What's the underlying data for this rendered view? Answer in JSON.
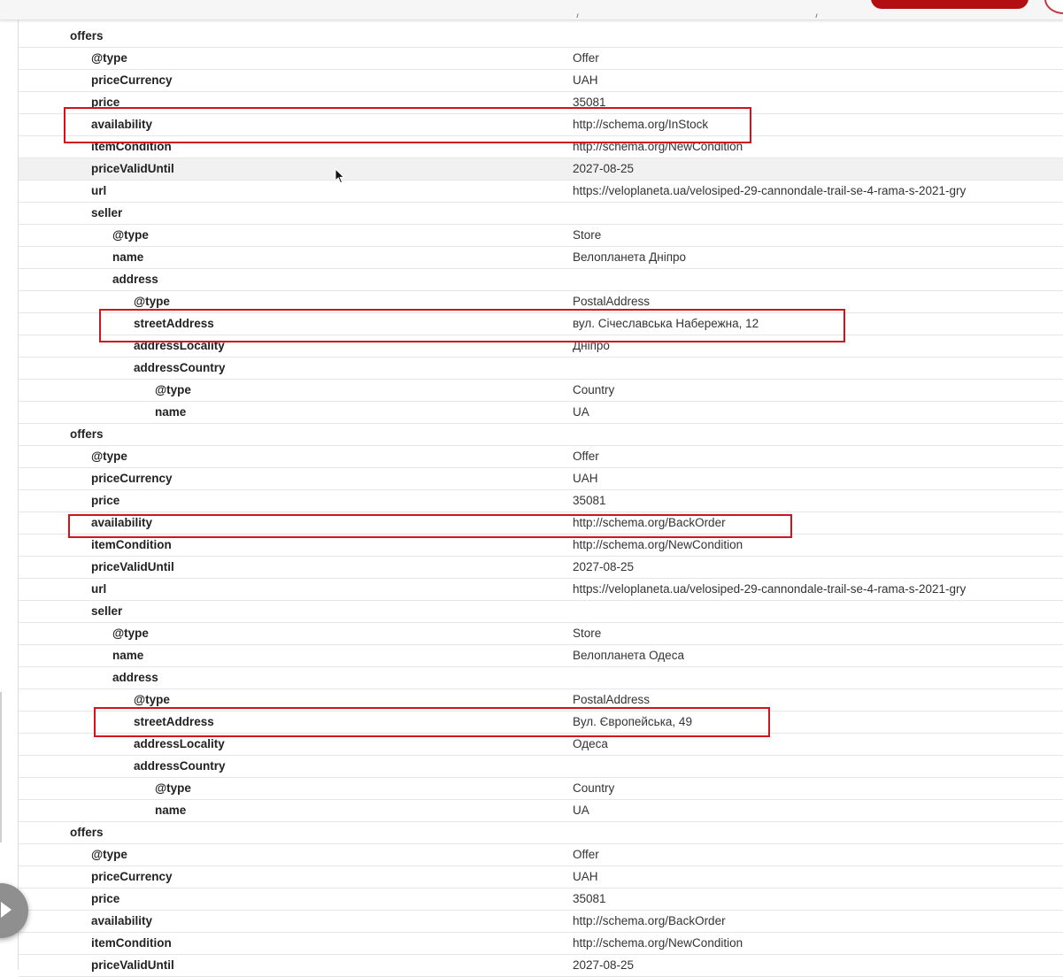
{
  "header": {
    "cut_text_left": "/",
    "cut_text_right": "/"
  },
  "rows": [
    {
      "key": "offers",
      "value": "",
      "indent": 0
    },
    {
      "key": "@type",
      "value": "Offer",
      "indent": 1
    },
    {
      "key": "priceCurrency",
      "value": "UAH",
      "indent": 1
    },
    {
      "key": "price",
      "value": "35081",
      "indent": 1
    },
    {
      "key": "availability",
      "value": "http://schema.org/InStock",
      "indent": 1
    },
    {
      "key": "itemCondition",
      "value": "http://schema.org/NewCondition",
      "indent": 1
    },
    {
      "key": "priceValidUntil",
      "value": "2027-08-25",
      "indent": 1,
      "hover": true
    },
    {
      "key": "url",
      "value": "https://veloplaneta.ua/velosiped-29-cannondale-trail-se-4-rama-s-2021-gry",
      "indent": 1
    },
    {
      "key": "seller",
      "value": "",
      "indent": 1
    },
    {
      "key": "@type",
      "value": "Store",
      "indent": 2
    },
    {
      "key": "name",
      "value": "Велопланета Дніпро",
      "indent": 2
    },
    {
      "key": "address",
      "value": "",
      "indent": 2
    },
    {
      "key": "@type",
      "value": "PostalAddress",
      "indent": 3
    },
    {
      "key": "streetAddress",
      "value": "вул. Січеславська Набережна, 12",
      "indent": 3
    },
    {
      "key": "addressLocality",
      "value": "Дніпро",
      "indent": 3
    },
    {
      "key": "addressCountry",
      "value": "",
      "indent": 3
    },
    {
      "key": "@type",
      "value": "Country",
      "indent": 4
    },
    {
      "key": "name",
      "value": "UA",
      "indent": 4
    },
    {
      "key": "offers",
      "value": "",
      "indent": 0
    },
    {
      "key": "@type",
      "value": "Offer",
      "indent": 1
    },
    {
      "key": "priceCurrency",
      "value": "UAH",
      "indent": 1
    },
    {
      "key": "price",
      "value": "35081",
      "indent": 1
    },
    {
      "key": "availability",
      "value": "http://schema.org/BackOrder",
      "indent": 1
    },
    {
      "key": "itemCondition",
      "value": "http://schema.org/NewCondition",
      "indent": 1
    },
    {
      "key": "priceValidUntil",
      "value": "2027-08-25",
      "indent": 1
    },
    {
      "key": "url",
      "value": "https://veloplaneta.ua/velosiped-29-cannondale-trail-se-4-rama-s-2021-gry",
      "indent": 1
    },
    {
      "key": "seller",
      "value": "",
      "indent": 1
    },
    {
      "key": "@type",
      "value": "Store",
      "indent": 2
    },
    {
      "key": "name",
      "value": "Велопланета Одеса",
      "indent": 2
    },
    {
      "key": "address",
      "value": "",
      "indent": 2
    },
    {
      "key": "@type",
      "value": "PostalAddress",
      "indent": 3
    },
    {
      "key": "streetAddress",
      "value": "Вул. Європейська, 49",
      "indent": 3
    },
    {
      "key": "addressLocality",
      "value": "Одеса",
      "indent": 3
    },
    {
      "key": "addressCountry",
      "value": "",
      "indent": 3
    },
    {
      "key": "@type",
      "value": "Country",
      "indent": 4
    },
    {
      "key": "name",
      "value": "UA",
      "indent": 4
    },
    {
      "key": "offers",
      "value": "",
      "indent": 0
    },
    {
      "key": "@type",
      "value": "Offer",
      "indent": 1
    },
    {
      "key": "priceCurrency",
      "value": "UAH",
      "indent": 1
    },
    {
      "key": "price",
      "value": "35081",
      "indent": 1
    },
    {
      "key": "availability",
      "value": "http://schema.org/BackOrder",
      "indent": 1
    },
    {
      "key": "itemCondition",
      "value": "http://schema.org/NewCondition",
      "indent": 1
    },
    {
      "key": "priceValidUntil",
      "value": "2027-08-25",
      "indent": 1
    }
  ],
  "colors": {
    "highlight": "#d1141b",
    "brand_button": "#b30f12"
  },
  "icons": {
    "cursor": "arrow-cursor-icon",
    "floating": "play-icon"
  }
}
